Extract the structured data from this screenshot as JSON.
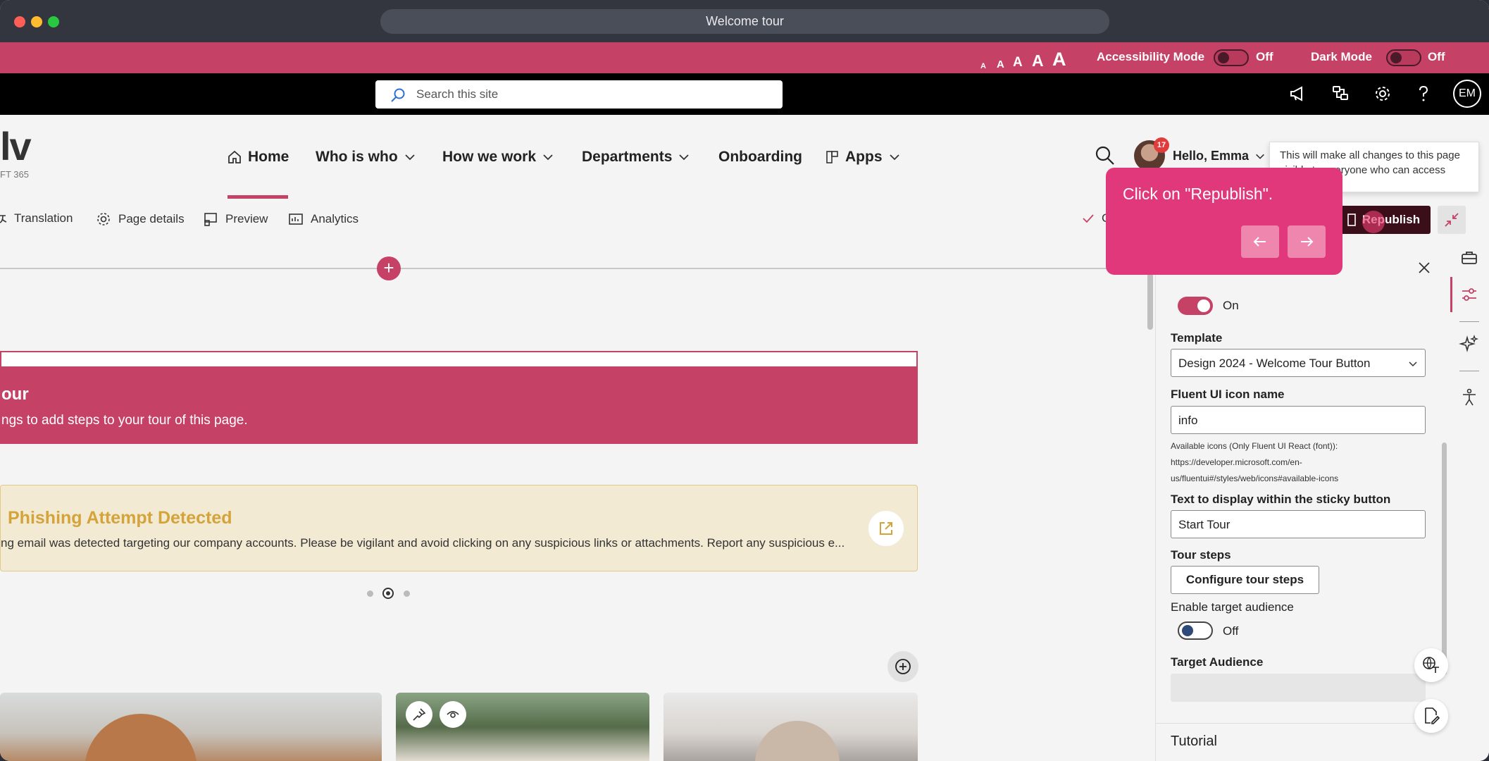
{
  "window": {
    "url_title": "Welcome tour"
  },
  "accessibility_bar": {
    "font_sizes": [
      "A",
      "A",
      "A",
      "A",
      "A"
    ],
    "accessibility_mode_label": "Accessibility Mode",
    "accessibility_mode_state": "Off",
    "dark_mode_label": "Dark Mode",
    "dark_mode_state": "Off"
  },
  "suite_bar": {
    "search_placeholder": "Search this site",
    "user_initials": "EM"
  },
  "site_header": {
    "logo_text": "lv",
    "logo_subtext": "FT 365",
    "nav": [
      {
        "label": "Home"
      },
      {
        "label": "Who is who"
      },
      {
        "label": "How we work"
      },
      {
        "label": "Departments"
      },
      {
        "label": "Onboarding"
      },
      {
        "label": "Apps"
      }
    ],
    "greeting": "Hello, Emma",
    "notification_count": "17"
  },
  "command_bar": {
    "translation": "Translation",
    "page_details": "Page details",
    "preview": "Preview",
    "analytics": "Analytics",
    "status_initial": "C",
    "republish": "Republish"
  },
  "tooltip_info": {
    "text": "This will make all changes to this page visible to everyone who can access your"
  },
  "tour_popover": {
    "text": "Click on \"Republish\"."
  },
  "canvas": {
    "tour_banner_title": "our",
    "tour_banner_desc": "ngs to add steps to your tour of this page.",
    "phish_title": "Phishing Attempt Detected",
    "phish_desc": "ng email was detected targeting our company accounts. Please be vigilant and avoid clicking on any suspicious links or attachments. Report any suspicious e..."
  },
  "property_pane": {
    "toggle1_state": "On",
    "template_label": "Template",
    "template_value": "Design 2024 - Welcome Tour Button",
    "icon_label": "Fluent UI icon name",
    "icon_value": "info",
    "icon_help_1": "Available icons (Only Fluent UI React (font)):",
    "icon_help_2": "https://developer.microsoft.com/en-",
    "icon_help_3": "us/fluentui#/styles/web/icons#available-icons",
    "sticky_label": "Text to display within the sticky button",
    "sticky_value": "Start Tour",
    "tour_steps_label": "Tour steps",
    "configure_button": "Configure tour steps",
    "audience_toggle_label": "Enable target audience",
    "audience_toggle_state": "Off",
    "audience_label": "Target Audience",
    "tutorial_label": "Tutorial"
  },
  "colors": {
    "brand": "#c54166",
    "popover": "#e0387a",
    "dark_button": "#3a0f1a",
    "warning_title": "#d4a33a"
  }
}
